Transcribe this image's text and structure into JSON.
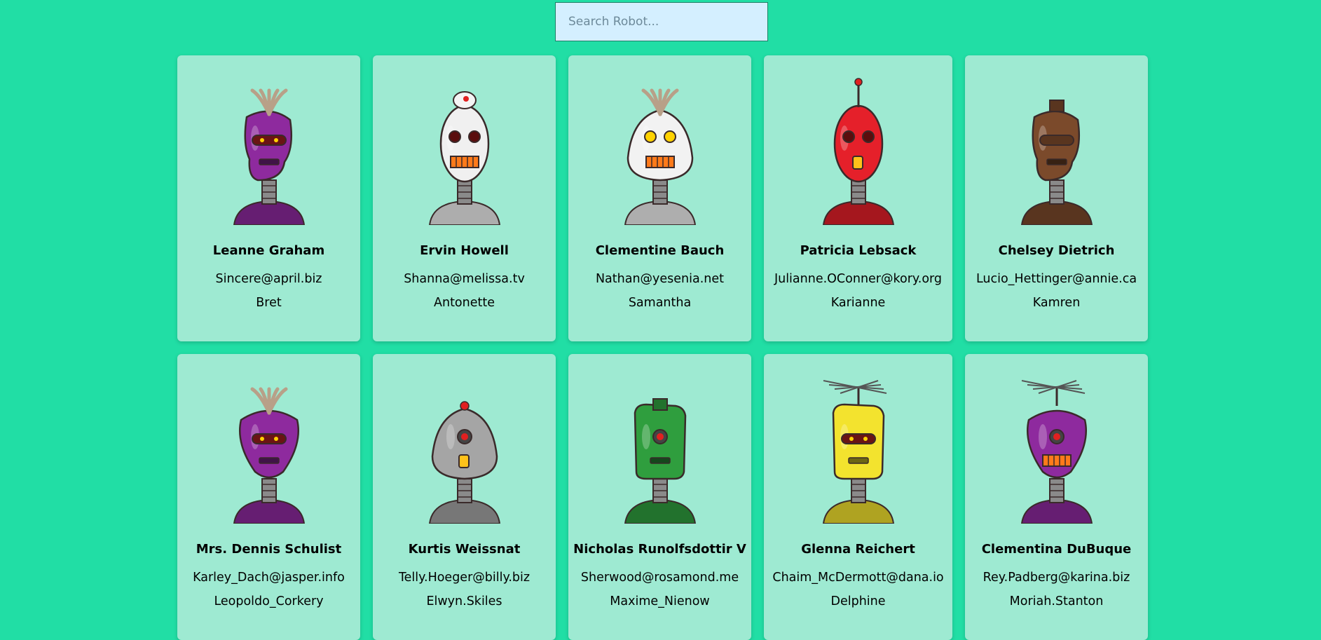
{
  "search": {
    "placeholder": "Search Robot..."
  },
  "robots": [
    {
      "name": "Leanne Graham",
      "email": "Sincere@april.biz",
      "username": "Bret",
      "color": "#8e2a9e",
      "head": "round",
      "topper": "tuft",
      "eyes": "visor",
      "mouth": "slot"
    },
    {
      "name": "Ervin Howell",
      "email": "Shanna@melissa.tv",
      "username": "Antonette",
      "color": "#f0f0f0",
      "head": "egg",
      "topper": "dish",
      "eyes": "two",
      "mouth": "grill"
    },
    {
      "name": "Clementine Bauch",
      "email": "Nathan@yesenia.net",
      "username": "Samantha",
      "color": "#f2f2f2",
      "head": "bulb",
      "topper": "tuft",
      "eyes": "two-yellow",
      "mouth": "grill"
    },
    {
      "name": "Patricia Lebsack",
      "email": "Julianne.OConner@kory.org",
      "username": "Karianne",
      "color": "#e5202a",
      "head": "egg",
      "topper": "antenna",
      "eyes": "two",
      "mouth": "tooth"
    },
    {
      "name": "Chelsey Dietrich",
      "email": "Lucio_Hettinger@annie.ca",
      "username": "Kamren",
      "color": "#7b4a2b",
      "head": "round",
      "topper": "cap",
      "eyes": "slot",
      "mouth": "slot"
    },
    {
      "name": "Mrs. Dennis Schulist",
      "email": "Karley_Dach@jasper.info",
      "username": "Leopoldo_Corkery",
      "color": "#8e2a9e",
      "head": "cone",
      "topper": "tuft",
      "eyes": "visor",
      "mouth": "slot"
    },
    {
      "name": "Kurtis Weissnat",
      "email": "Telly.Hoeger@billy.biz",
      "username": "Elwyn.Skiles",
      "color": "#a5a5a5",
      "head": "bulb",
      "topper": "bulb",
      "eyes": "one",
      "mouth": "tooth"
    },
    {
      "name": "Nicholas Runolfsdottir V",
      "email": "Sherwood@rosamond.me",
      "username": "Maxime_Nienow",
      "color": "#2f9e3e",
      "head": "box",
      "topper": "cap",
      "eyes": "one",
      "mouth": "slot"
    },
    {
      "name": "Glenna Reichert",
      "email": "Chaim_McDermott@dana.io",
      "username": "Delphine",
      "color": "#f3e32e",
      "head": "box",
      "topper": "tv",
      "eyes": "visor",
      "mouth": "slot"
    },
    {
      "name": "Clementina DuBuque",
      "email": "Rey.Padberg@karina.biz",
      "username": "Moriah.Stanton",
      "color": "#8e2a9e",
      "head": "cone",
      "topper": "tv",
      "eyes": "one",
      "mouth": "grill"
    }
  ]
}
